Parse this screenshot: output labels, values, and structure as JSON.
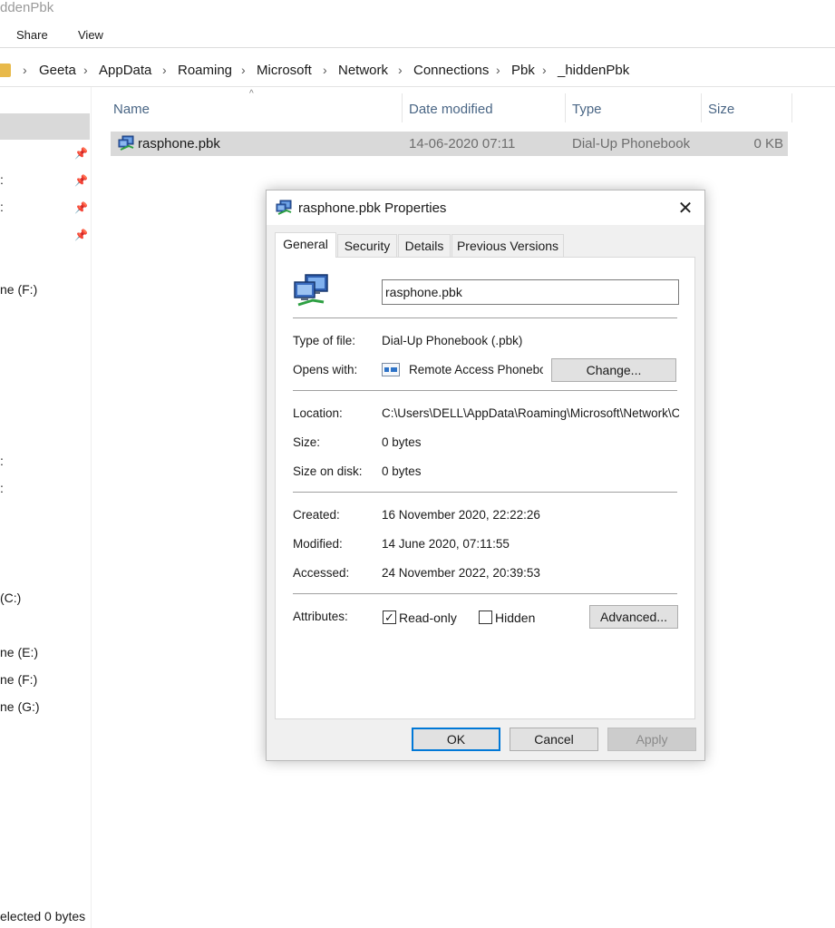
{
  "window": {
    "title_fragment": "ddenPbk"
  },
  "ribbon": {
    "tabs": [
      "Share",
      "View"
    ]
  },
  "address_bar": {
    "crumbs": [
      "Geeta",
      "AppData",
      "Roaming",
      "Microsoft",
      "Network",
      "Connections",
      "Pbk",
      "_hiddenPbk"
    ]
  },
  "nav_pane": {
    "items": [
      ":",
      ":",
      ":",
      "ne (F:)",
      ":",
      ":",
      "(C:)",
      "ne (E:)",
      "ne (F:)",
      "ne (G:)"
    ]
  },
  "file_list": {
    "columns": [
      "Name",
      "Date modified",
      "Type",
      "Size"
    ],
    "rows": [
      {
        "name": "rasphone.pbk",
        "date_modified": "14-06-2020 07:11",
        "type": "Dial-Up Phonebook",
        "size": "0 KB"
      }
    ]
  },
  "status_bar": {
    "text": "elected  0 bytes"
  },
  "dialog": {
    "title": "rasphone.pbk Properties",
    "close_glyph": "✕",
    "tabs": [
      "General",
      "Security",
      "Details",
      "Previous Versions"
    ],
    "active_tab": "General",
    "file_name": "rasphone.pbk",
    "fields": {
      "type_label": "Type of file:",
      "type_value": "Dial-Up Phonebook (.pbk)",
      "opens_label": "Opens with:",
      "opens_value": "Remote Access Phonebook",
      "change_button": "Change...",
      "location_label": "Location:",
      "location_value": "C:\\Users\\DELL\\AppData\\Roaming\\Microsoft\\Network\\Connections\\Pbk",
      "size_label": "Size:",
      "size_value": "0 bytes",
      "size_on_disk_label": "Size on disk:",
      "size_on_disk_value": "0 bytes",
      "created_label": "Created:",
      "created_value": "16 November 2020, 22:22:26",
      "modified_label": "Modified:",
      "modified_value": "14 June 2020, 07:11:55",
      "accessed_label": "Accessed:",
      "accessed_value": "24 November 2022, 20:39:53",
      "attributes_label": "Attributes:",
      "readonly_label": "Read-only",
      "readonly_checked": true,
      "hidden_label": "Hidden",
      "hidden_checked": false,
      "advanced_button": "Advanced..."
    },
    "buttons": {
      "ok": "OK",
      "cancel": "Cancel",
      "apply": "Apply"
    }
  },
  "icons": {
    "phonebook": "network-computers-icon",
    "pin": "pin-icon",
    "folder": "folder-icon",
    "chevron": "chevron-right-icon",
    "app": "remote-access-app-icon"
  },
  "colors": {
    "selection": "#d9d9d9",
    "accent": "#0078d7",
    "header_text": "#4a6685"
  }
}
